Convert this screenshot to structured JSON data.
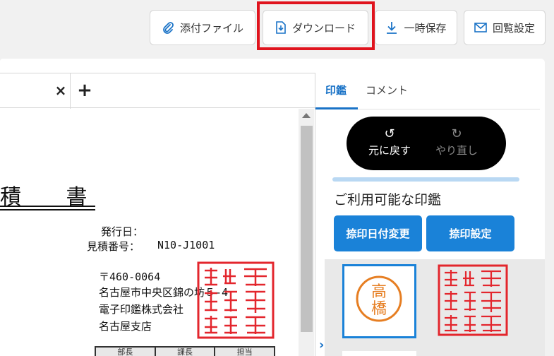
{
  "toolbar": {
    "attach_label": "添付ファイル",
    "download_label": "ダウンロード",
    "save_label": "一時保存",
    "circulation_label": "回覧設定"
  },
  "document": {
    "title": "積 書",
    "issue_date_label": "発行日：",
    "estimate_no_label": "見積番号：",
    "estimate_no": "N10-J1001",
    "postal": "〒460-0064",
    "address": "名古屋市中央区錦の坊５-4",
    "company": "電子印鑑株式会社",
    "branch": "名古屋支店",
    "stamp_columns": [
      "部長",
      "課長",
      "担当"
    ]
  },
  "side_panel": {
    "tabs": [
      {
        "label": "印鑑",
        "active": true
      },
      {
        "label": "コメント",
        "active": false
      }
    ],
    "undo_label": "元に戻す",
    "redo_label": "やり直し",
    "section_title": "ご利用可能な印鑑",
    "date_stamp_button": "捺印日付変更",
    "stamp_settings_button": "捺印設定",
    "seals": [
      {
        "text": "高橋",
        "color": "#e67e22"
      }
    ]
  },
  "colors": {
    "accent": "#1a82d8",
    "highlight": "#e0141e",
    "seal_red": "#e3262d",
    "seal_orange": "#e67e22"
  }
}
